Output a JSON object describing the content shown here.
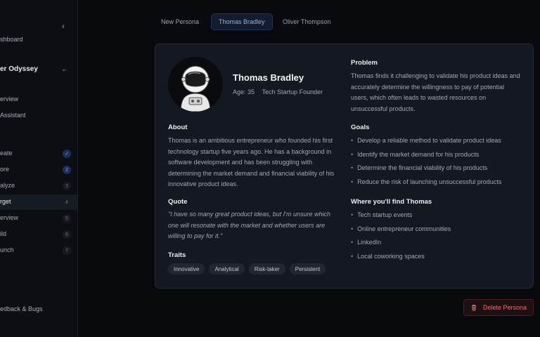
{
  "sidebar": {
    "collapse_glyph": "‹",
    "dashboard": "shboard",
    "project": "er Odyssey",
    "project_chevron": "⌄",
    "overview": "erview",
    "assistant": " Assistant",
    "steps": [
      {
        "label": "eate",
        "badge": "✓",
        "state": "done"
      },
      {
        "label": "ore",
        "badge": "2",
        "state": "done"
      },
      {
        "label": "alyze",
        "badge": "3",
        "state": "todo"
      },
      {
        "label": "rget",
        "badge": "4",
        "state": "active"
      },
      {
        "label": "erview",
        "badge": "5",
        "state": "todo"
      },
      {
        "label": "ild",
        "badge": "6",
        "state": "todo"
      },
      {
        "label": "unch",
        "badge": "7",
        "state": "todo"
      }
    ],
    "feedback": "edback & Bugs"
  },
  "tabs": [
    {
      "label": "New Persona",
      "active": false
    },
    {
      "label": "Thomas Bradley",
      "active": true
    },
    {
      "label": "Oliver Thompson",
      "active": false
    }
  ],
  "persona": {
    "name": "Thomas Bradley",
    "age": "Age: 35",
    "role": "Tech Startup Founder",
    "about_heading": "About",
    "about": "Thomas is an ambitious entrepreneur who founded his first technology startup five years ago. He has a background in software development and has been struggling with determining the market demand and financial viability of his innovative product ideas.",
    "quote_heading": "Quote",
    "quote": "\"I have so many great product ideas, but I'm unsure which one will resonate with the market and whether users are willing to pay for it.\"",
    "traits_heading": "Traits",
    "traits": [
      "Innovative",
      "Analytical",
      "Risk-taker",
      "Persistent"
    ],
    "problem_heading": "Problem",
    "problem": "Thomas finds it challenging to validate his product ideas and accurately determine the willingness to pay of potential users, which often leads to wasted resources on unsuccessful products.",
    "goals_heading": "Goals",
    "goals": [
      "Develop a reliable method to validate product ideas",
      "Identify the market demand for his products",
      "Determine the financial viability of his products",
      "Reduce the risk of launching unsuccessful products"
    ],
    "where_heading": "Where you'll find Thomas",
    "where": [
      "Tech startup events",
      "Online entrepreneur communities",
      "LinkedIn",
      "Local coworking spaces"
    ]
  },
  "actions": {
    "delete_label": "Delete Persona"
  },
  "icons": {
    "avatar": "astronaut-illustration",
    "delete": "trash-icon"
  },
  "colors": {
    "accent": "#8db0ef",
    "danger": "#e46c72"
  }
}
